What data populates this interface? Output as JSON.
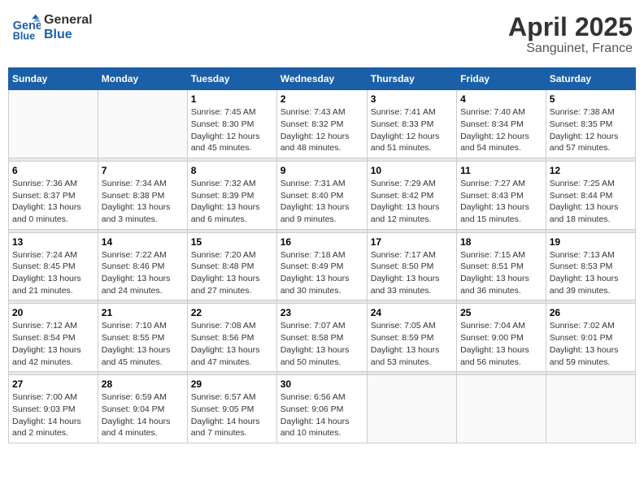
{
  "header": {
    "logo_line1": "General",
    "logo_line2": "Blue",
    "month": "April 2025",
    "location": "Sanguinet, France"
  },
  "weekdays": [
    "Sunday",
    "Monday",
    "Tuesday",
    "Wednesday",
    "Thursday",
    "Friday",
    "Saturday"
  ],
  "weeks": [
    [
      {
        "day": "",
        "info": ""
      },
      {
        "day": "",
        "info": ""
      },
      {
        "day": "1",
        "info": "Sunrise: 7:45 AM\nSunset: 8:30 PM\nDaylight: 12 hours\nand 45 minutes."
      },
      {
        "day": "2",
        "info": "Sunrise: 7:43 AM\nSunset: 8:32 PM\nDaylight: 12 hours\nand 48 minutes."
      },
      {
        "day": "3",
        "info": "Sunrise: 7:41 AM\nSunset: 8:33 PM\nDaylight: 12 hours\nand 51 minutes."
      },
      {
        "day": "4",
        "info": "Sunrise: 7:40 AM\nSunset: 8:34 PM\nDaylight: 12 hours\nand 54 minutes."
      },
      {
        "day": "5",
        "info": "Sunrise: 7:38 AM\nSunset: 8:35 PM\nDaylight: 12 hours\nand 57 minutes."
      }
    ],
    [
      {
        "day": "6",
        "info": "Sunrise: 7:36 AM\nSunset: 8:37 PM\nDaylight: 13 hours\nand 0 minutes."
      },
      {
        "day": "7",
        "info": "Sunrise: 7:34 AM\nSunset: 8:38 PM\nDaylight: 13 hours\nand 3 minutes."
      },
      {
        "day": "8",
        "info": "Sunrise: 7:32 AM\nSunset: 8:39 PM\nDaylight: 13 hours\nand 6 minutes."
      },
      {
        "day": "9",
        "info": "Sunrise: 7:31 AM\nSunset: 8:40 PM\nDaylight: 13 hours\nand 9 minutes."
      },
      {
        "day": "10",
        "info": "Sunrise: 7:29 AM\nSunset: 8:42 PM\nDaylight: 13 hours\nand 12 minutes."
      },
      {
        "day": "11",
        "info": "Sunrise: 7:27 AM\nSunset: 8:43 PM\nDaylight: 13 hours\nand 15 minutes."
      },
      {
        "day": "12",
        "info": "Sunrise: 7:25 AM\nSunset: 8:44 PM\nDaylight: 13 hours\nand 18 minutes."
      }
    ],
    [
      {
        "day": "13",
        "info": "Sunrise: 7:24 AM\nSunset: 8:45 PM\nDaylight: 13 hours\nand 21 minutes."
      },
      {
        "day": "14",
        "info": "Sunrise: 7:22 AM\nSunset: 8:46 PM\nDaylight: 13 hours\nand 24 minutes."
      },
      {
        "day": "15",
        "info": "Sunrise: 7:20 AM\nSunset: 8:48 PM\nDaylight: 13 hours\nand 27 minutes."
      },
      {
        "day": "16",
        "info": "Sunrise: 7:18 AM\nSunset: 8:49 PM\nDaylight: 13 hours\nand 30 minutes."
      },
      {
        "day": "17",
        "info": "Sunrise: 7:17 AM\nSunset: 8:50 PM\nDaylight: 13 hours\nand 33 minutes."
      },
      {
        "day": "18",
        "info": "Sunrise: 7:15 AM\nSunset: 8:51 PM\nDaylight: 13 hours\nand 36 minutes."
      },
      {
        "day": "19",
        "info": "Sunrise: 7:13 AM\nSunset: 8:53 PM\nDaylight: 13 hours\nand 39 minutes."
      }
    ],
    [
      {
        "day": "20",
        "info": "Sunrise: 7:12 AM\nSunset: 8:54 PM\nDaylight: 13 hours\nand 42 minutes."
      },
      {
        "day": "21",
        "info": "Sunrise: 7:10 AM\nSunset: 8:55 PM\nDaylight: 13 hours\nand 45 minutes."
      },
      {
        "day": "22",
        "info": "Sunrise: 7:08 AM\nSunset: 8:56 PM\nDaylight: 13 hours\nand 47 minutes."
      },
      {
        "day": "23",
        "info": "Sunrise: 7:07 AM\nSunset: 8:58 PM\nDaylight: 13 hours\nand 50 minutes."
      },
      {
        "day": "24",
        "info": "Sunrise: 7:05 AM\nSunset: 8:59 PM\nDaylight: 13 hours\nand 53 minutes."
      },
      {
        "day": "25",
        "info": "Sunrise: 7:04 AM\nSunset: 9:00 PM\nDaylight: 13 hours\nand 56 minutes."
      },
      {
        "day": "26",
        "info": "Sunrise: 7:02 AM\nSunset: 9:01 PM\nDaylight: 13 hours\nand 59 minutes."
      }
    ],
    [
      {
        "day": "27",
        "info": "Sunrise: 7:00 AM\nSunset: 9:03 PM\nDaylight: 14 hours\nand 2 minutes."
      },
      {
        "day": "28",
        "info": "Sunrise: 6:59 AM\nSunset: 9:04 PM\nDaylight: 14 hours\nand 4 minutes."
      },
      {
        "day": "29",
        "info": "Sunrise: 6:57 AM\nSunset: 9:05 PM\nDaylight: 14 hours\nand 7 minutes."
      },
      {
        "day": "30",
        "info": "Sunrise: 6:56 AM\nSunset: 9:06 PM\nDaylight: 14 hours\nand 10 minutes."
      },
      {
        "day": "",
        "info": ""
      },
      {
        "day": "",
        "info": ""
      },
      {
        "day": "",
        "info": ""
      }
    ]
  ]
}
